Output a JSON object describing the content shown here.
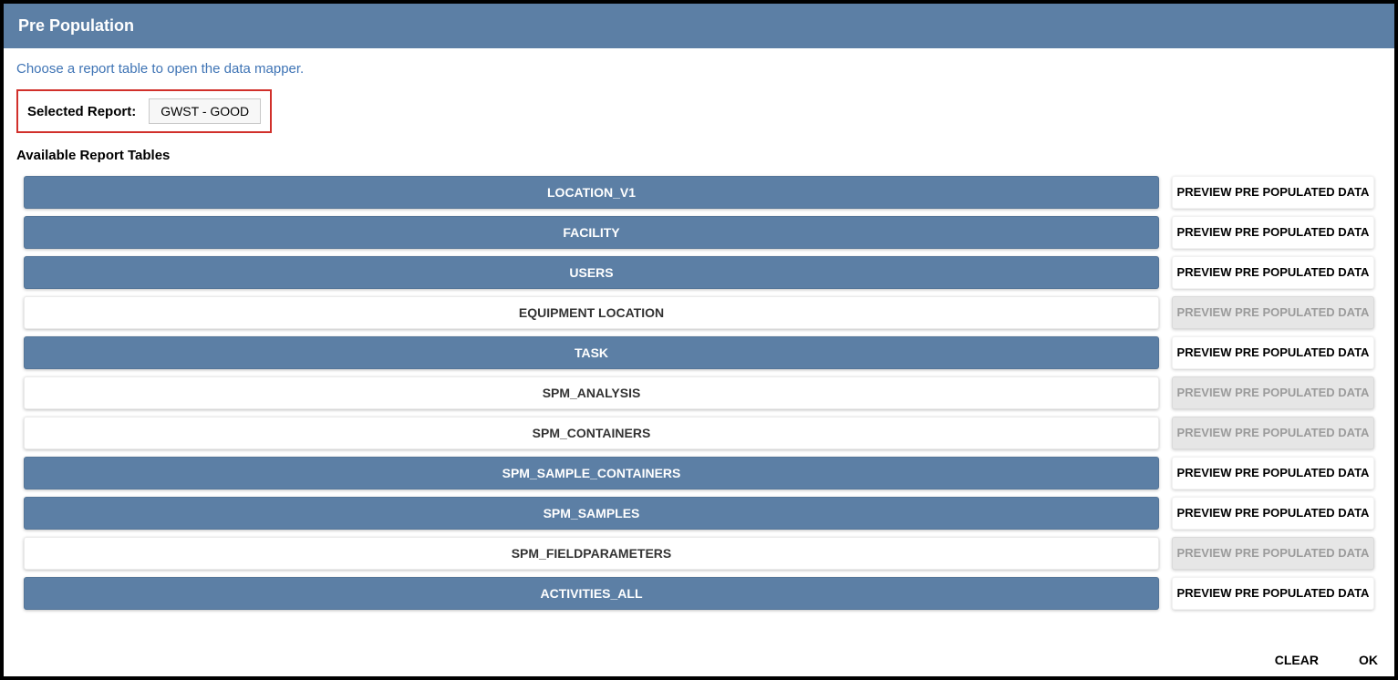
{
  "header": {
    "title": "Pre Population"
  },
  "instruction": "Choose a report table to open the data mapper.",
  "selectedReport": {
    "label": "Selected Report:",
    "value": "GWST - GOOD"
  },
  "availableLabel": "Available Report Tables",
  "previewLabel": "PREVIEW PRE POPULATED DATA",
  "tables": [
    {
      "name": "LOCATION_V1",
      "active": true,
      "previewEnabled": true
    },
    {
      "name": "FACILITY",
      "active": true,
      "previewEnabled": true
    },
    {
      "name": "USERS",
      "active": true,
      "previewEnabled": true
    },
    {
      "name": "EQUIPMENT LOCATION",
      "active": false,
      "previewEnabled": false
    },
    {
      "name": "TASK",
      "active": true,
      "previewEnabled": true
    },
    {
      "name": "SPM_ANALYSIS",
      "active": false,
      "previewEnabled": false
    },
    {
      "name": "SPM_CONTAINERS",
      "active": false,
      "previewEnabled": false
    },
    {
      "name": "SPM_SAMPLE_CONTAINERS",
      "active": true,
      "previewEnabled": true
    },
    {
      "name": "SPM_SAMPLES",
      "active": true,
      "previewEnabled": true
    },
    {
      "name": "SPM_FIELDPARAMETERS",
      "active": false,
      "previewEnabled": false
    },
    {
      "name": "ACTIVITIES_ALL",
      "active": true,
      "previewEnabled": true
    }
  ],
  "footer": {
    "clear": "CLEAR",
    "ok": "OK"
  }
}
